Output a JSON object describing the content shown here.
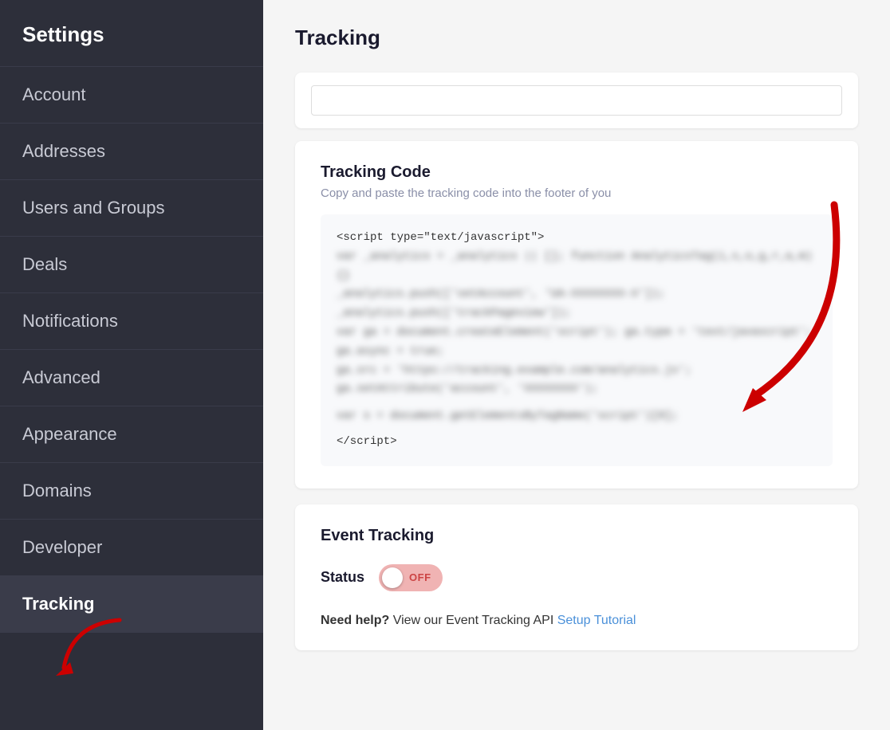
{
  "sidebar": {
    "title": "Settings",
    "items": [
      {
        "id": "account",
        "label": "Account",
        "active": false
      },
      {
        "id": "addresses",
        "label": "Addresses",
        "active": false
      },
      {
        "id": "users-and-groups",
        "label": "Users and Groups",
        "active": false
      },
      {
        "id": "deals",
        "label": "Deals",
        "active": false
      },
      {
        "id": "notifications",
        "label": "Notifications",
        "active": false
      },
      {
        "id": "advanced",
        "label": "Advanced",
        "active": false
      },
      {
        "id": "appearance",
        "label": "Appearance",
        "active": false
      },
      {
        "id": "domains",
        "label": "Domains",
        "active": false
      },
      {
        "id": "developer",
        "label": "Developer",
        "active": false
      },
      {
        "id": "tracking",
        "label": "Tracking",
        "active": true
      }
    ]
  },
  "main": {
    "page_title": "Tracking",
    "tracking_code_section": {
      "title": "Tracking Code",
      "description": "Copy and paste the tracking code into the footer of you",
      "code_start": "<script type=\"text/javascript\">",
      "code_end": "<\\/script>"
    },
    "event_tracking_section": {
      "title": "Event Tracking",
      "status_label": "Status",
      "toggle_state": "OFF",
      "help_text": "Need help?",
      "help_body": " View our Event Tracking API ",
      "help_link_text": "Setup Tutorial"
    }
  }
}
